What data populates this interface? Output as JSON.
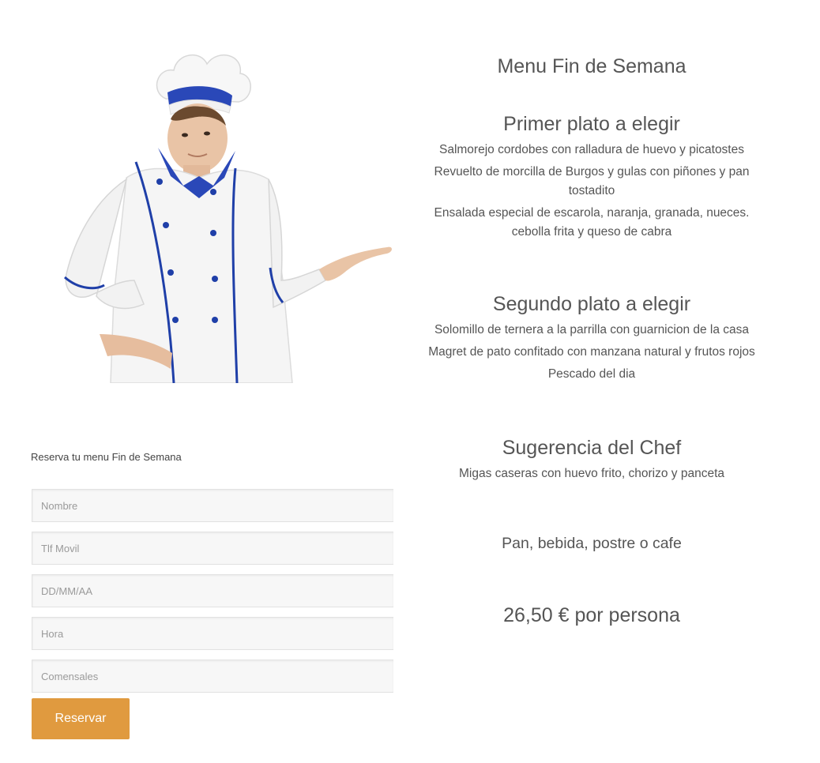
{
  "image": {
    "alt": "Chef pointing to the menu",
    "name": "chef-illustration"
  },
  "menu": {
    "title": "Menu Fin de Semana",
    "courses": [
      {
        "title": "Primer plato a elegir",
        "items": [
          "Salmorejo cordobes con ralladura de huevo y picatostes",
          "Revuelto de morcilla de Burgos y gulas con piñones y pan tostadito",
          "Ensalada especial de escarola, naranja, granada, nueces. cebolla frita y queso de cabra"
        ]
      },
      {
        "title": "Segundo plato a elegir",
        "items": [
          "Solomillo de ternera a la parrilla con guarnicion de la casa",
          "Magret de pato confitado con manzana natural y frutos rojos",
          "Pescado del dia"
        ]
      },
      {
        "title": "Sugerencia del Chef",
        "items": [
          "Migas caseras con huevo frito, chorizo y panceta"
        ]
      }
    ],
    "extras": "Pan, bebida, postre o cafe",
    "price": "26,50 € por persona"
  },
  "form": {
    "title": "Reserva tu menu Fin de Semana",
    "fields": [
      {
        "placeholder": "Nombre",
        "value": ""
      },
      {
        "placeholder": "Tlf Movil",
        "value": ""
      },
      {
        "placeholder": "DD/MM/AA",
        "value": ""
      },
      {
        "placeholder": "Hora",
        "value": ""
      },
      {
        "placeholder": "Comensales",
        "value": ""
      }
    ],
    "submit_label": "Reservar"
  },
  "colors": {
    "accent_button": "#e09a3f",
    "chef_trim_blue": "#1f3fa8",
    "text": "#555555"
  }
}
